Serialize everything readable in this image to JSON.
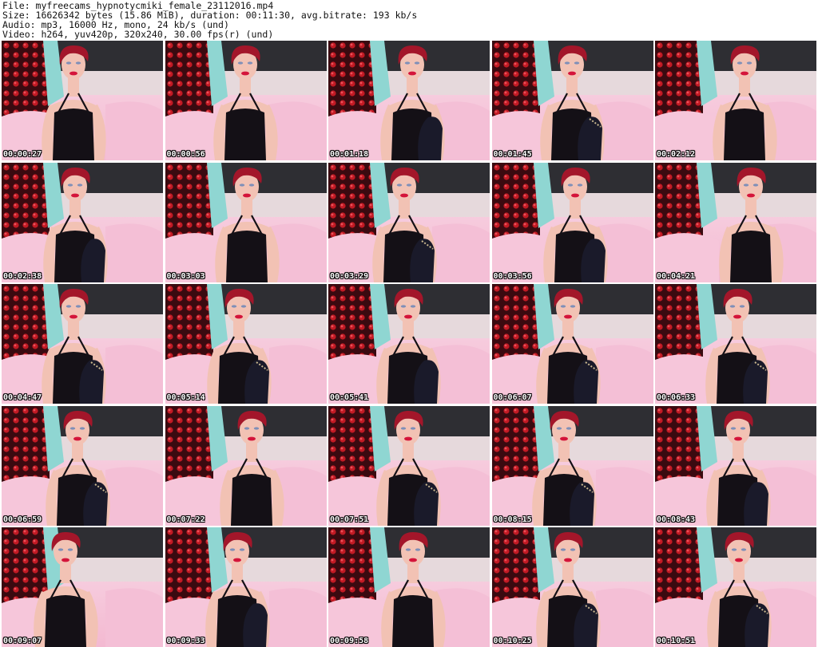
{
  "header": {
    "file_line": "File: myfreecams_hypnotycmiki_female_23112016.mp4",
    "size_line": "Size: 16626342 bytes (15.86 MiB), duration: 00:11:30, avg.bitrate: 193 kb/s",
    "audio_line": "Audio: mp3, 16000 Hz, mono, 24 kb/s (und)",
    "video_line": "Video: h264, yuv420p, 320x240, 30.00 fps(r) (und)"
  },
  "thumbnails": [
    {
      "timestamp": "00:00:27"
    },
    {
      "timestamp": "00:00:56"
    },
    {
      "timestamp": "00:01:18"
    },
    {
      "timestamp": "00:01:45"
    },
    {
      "timestamp": "00:02:12"
    },
    {
      "timestamp": "00:02:38"
    },
    {
      "timestamp": "00:03:03"
    },
    {
      "timestamp": "00:03:29"
    },
    {
      "timestamp": "00:03:56"
    },
    {
      "timestamp": "00:04:21"
    },
    {
      "timestamp": "00:04:47"
    },
    {
      "timestamp": "00:05:14"
    },
    {
      "timestamp": "00:05:41"
    },
    {
      "timestamp": "00:06:07"
    },
    {
      "timestamp": "00:06:33"
    },
    {
      "timestamp": "00:06:59"
    },
    {
      "timestamp": "00:07:22"
    },
    {
      "timestamp": "00:07:51"
    },
    {
      "timestamp": "00:08:15"
    },
    {
      "timestamp": "00:08:43"
    },
    {
      "timestamp": "00:09:07"
    },
    {
      "timestamp": "00:09:33"
    },
    {
      "timestamp": "00:09:58"
    },
    {
      "timestamp": "00:10:25"
    },
    {
      "timestamp": "00:10:51"
    }
  ],
  "colors": {
    "background": "#ffffff",
    "header_text": "#111111",
    "bedding_pink": "#f7cfe0",
    "wall_red_dark": "#3a0a10",
    "wall_red_dots": "#c21a24",
    "headboard_gray": "#2e2e33",
    "cushion_teal": "#8fd6d2",
    "hair_red": "#a3162a",
    "skin": "#f2c2b4",
    "garment_black": "#141016"
  }
}
